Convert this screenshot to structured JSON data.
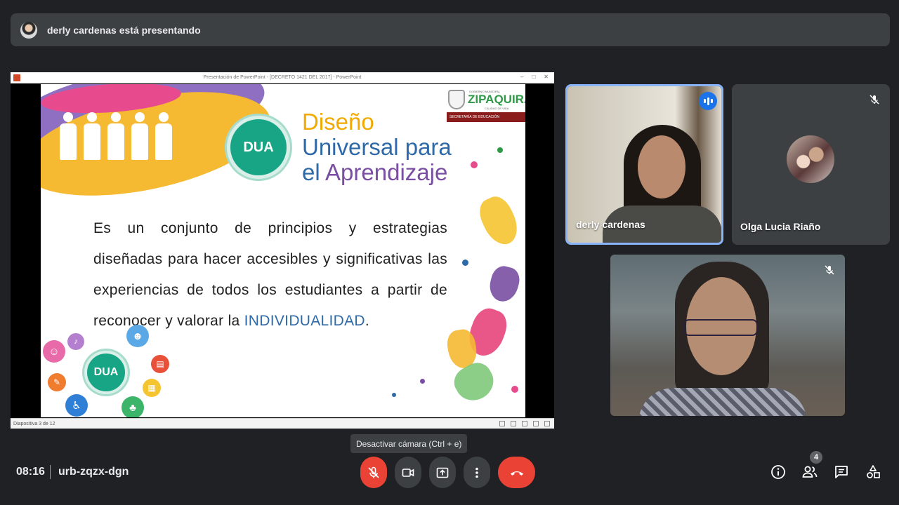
{
  "banner": {
    "text": "derly cardenas está presentando"
  },
  "presentation": {
    "window_title": "Presentación de PowerPoint - [DECRETO 1421 DEL 2017] - PowerPoint",
    "status_text": "Diapositiva 3 de 12",
    "slide": {
      "badge_label": "DUA",
      "small_badge_label": "DUA",
      "title_line1": "Diseño",
      "title_line2": "Universal para",
      "title_line3a": "el",
      "title_line3b": "Aprendizaje",
      "logo_small": "GOBIERNO MUNICIPAL",
      "logo_name": "ZIPAQUIRÁ",
      "logo_motto": "CALIDAD DE VIDA",
      "logo_bar": "SECRETARÍA DE EDUCACIÓN",
      "body_text": "Es un conjunto de principios y estrategias diseñadas para hacer accesibles y significativas las experiencias de todos los estudiantes  a partir de reconocer y valorar la",
      "body_highlight": "INDIVIDUALIDAD",
      "body_end": "."
    }
  },
  "participants": [
    {
      "name": "derly cardenas",
      "state": "speaking"
    },
    {
      "name": "Olga Lucia Riaño",
      "state": "muted"
    },
    {
      "name": "",
      "state": "muted"
    }
  ],
  "tooltip": {
    "text": "Desactivar cámara (Ctrl + e)"
  },
  "meeting": {
    "time": "08:16",
    "code": "urb-zqzx-dgn"
  },
  "people_count": "4",
  "colors": {
    "background": "#202124",
    "danger": "#ea4335",
    "speaking": "#1a73e8",
    "dua_green": "#17a585"
  }
}
